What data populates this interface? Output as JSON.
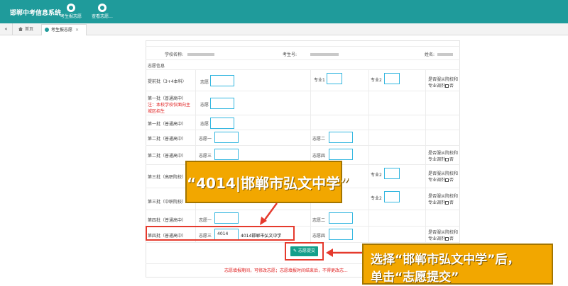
{
  "header": {
    "system_title": "邯郸中考信息系统",
    "nav": [
      {
        "label": "考生报志愿"
      },
      {
        "label": "查看志愿..."
      }
    ]
  },
  "tabs": {
    "home_label": "首页",
    "active_label": "考生报志愿"
  },
  "form": {
    "school_label": "学校名称:",
    "exam_no_label": "考生号:",
    "name_label": "姓名:",
    "section_title": "志愿信息",
    "rows": [
      {
        "batch": "提前批（3+4本科）",
        "choice": "志愿",
        "major1": "专业1",
        "major2": "专业2",
        "adjust": "是否服从院校和",
        "adjust2": "专业调剂",
        "no": "否"
      },
      {
        "batch": "第一批（普通高中）",
        "note1": "注：本校学校仅面向主",
        "note2": "城区招生",
        "choice": "志愿"
      },
      {
        "batch": "第一批（普通高中）",
        "choice": "志愿"
      },
      {
        "batch": "第二批（普通高中）",
        "choice1": "志愿一",
        "choice2": "志愿二"
      },
      {
        "batch": "第二批（普通高中）",
        "choice3": "志愿三",
        "choice4": "志愿四",
        "adjust": "是否服从院校和",
        "adjust2": "专业调剂",
        "no": "否"
      },
      {
        "batch": "第三批（高职院校）",
        "major2": "专业2",
        "adjust": "是否服从院校和",
        "adjust2": "专业调剂",
        "no": "否"
      },
      {
        "batch": "第三批（中职院校）",
        "major2": "专业2",
        "adjust": "是否服从院校和",
        "adjust2": "专业调剂",
        "no": "否"
      },
      {
        "batch": "第四批（普通高中）",
        "choice1": "志愿一",
        "choice2": "志愿二"
      },
      {
        "batch": "第四批（普通高中）",
        "choice3": "志愿三",
        "choice3_value": "4014",
        "choice3_school": "4014邯郸市弘文中学",
        "choice4": "志愿四",
        "adjust": "是否服从院校和",
        "adjust2": "专业调剂",
        "no": "否"
      }
    ],
    "submit_label": "志愿提交",
    "footer_notice": "志愿填报期间，可修改志愿；志愿填报时间结束后，不得更改志..."
  },
  "callouts": {
    "school_quote": "“4014|邯郸市弘文中学”",
    "instruction_line1": "选择“邯郸市弘文中学”后，",
    "instruction_line2": "单击“志愿提交”"
  },
  "colors": {
    "header_teal": "#1f9b9b",
    "field_border": "#35b7e0",
    "submit_green": "#139f8b",
    "highlight_red": "#e53a2d",
    "callout_orange": "#f2a700"
  }
}
